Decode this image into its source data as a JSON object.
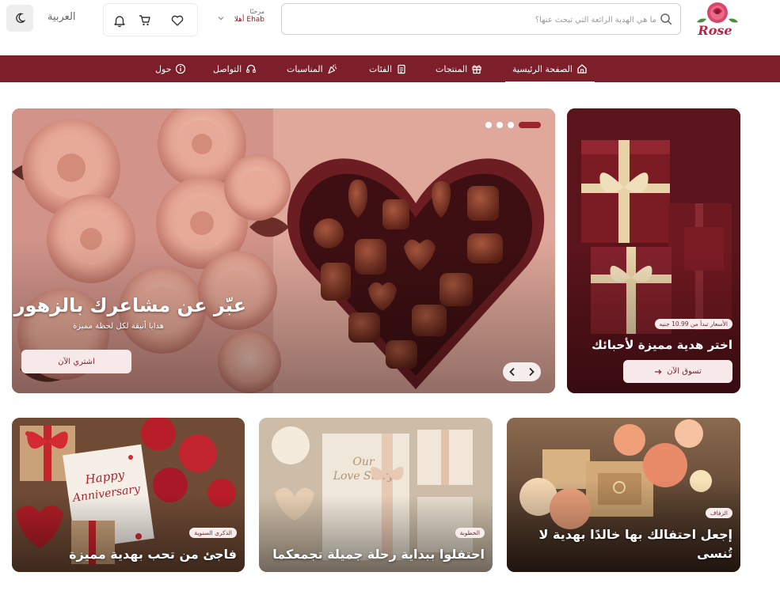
{
  "header": {
    "logo_text": "Rose",
    "search_placeholder": "ما هي الهدية الرائعة التي تبحث عنها؟",
    "greeting_label": "مرحبًا",
    "greeting_name": "أهلا Ehab",
    "language_label": "العربية",
    "icons": [
      "search-icon",
      "chevron-down-icon",
      "bell-icon",
      "cart-icon",
      "heart-icon",
      "moon-icon"
    ]
  },
  "nav": {
    "items": [
      {
        "label": "الصفحة الرئيسية",
        "icon": "home-icon",
        "active": true
      },
      {
        "label": "المنتجات",
        "icon": "gift-icon",
        "active": false
      },
      {
        "label": "الفئات",
        "icon": "clipboard-icon",
        "active": false
      },
      {
        "label": "المناسبات",
        "icon": "party-popper-icon",
        "active": false
      },
      {
        "label": "التواصل",
        "icon": "headset-icon",
        "active": false
      },
      {
        "label": "حول",
        "icon": "info-icon",
        "active": false
      }
    ]
  },
  "hero": {
    "title": "عبّر عن مشاعرك بالزهور",
    "subtitle": "هدايا أنيقة لكل لحظة مميزة",
    "cta_label": "اشتري الآن",
    "slide_count": 4,
    "active_slide": 1
  },
  "promo": {
    "badge": "الأسعار تبدأ من 10.99 جنيه",
    "title": "اختر هدية مميزة لأحبائك",
    "cta_label": "تسوق الآن"
  },
  "cards": [
    {
      "badge": "الزفاف",
      "title": "إجعل احتفالك بها خالدًا بهدية لا تُنسى"
    },
    {
      "badge": "الخطوبة",
      "title": "احتفلوا ببداية رحلة جميلة تجمعكما"
    },
    {
      "badge": "الذكرى السنوية",
      "title": "فاجئ من تحب بهدية مميزة"
    }
  ],
  "colors": {
    "brand": "#7d1f2a",
    "accent_soft": "#f7e9e9",
    "text_muted": "#9a9a9a"
  }
}
